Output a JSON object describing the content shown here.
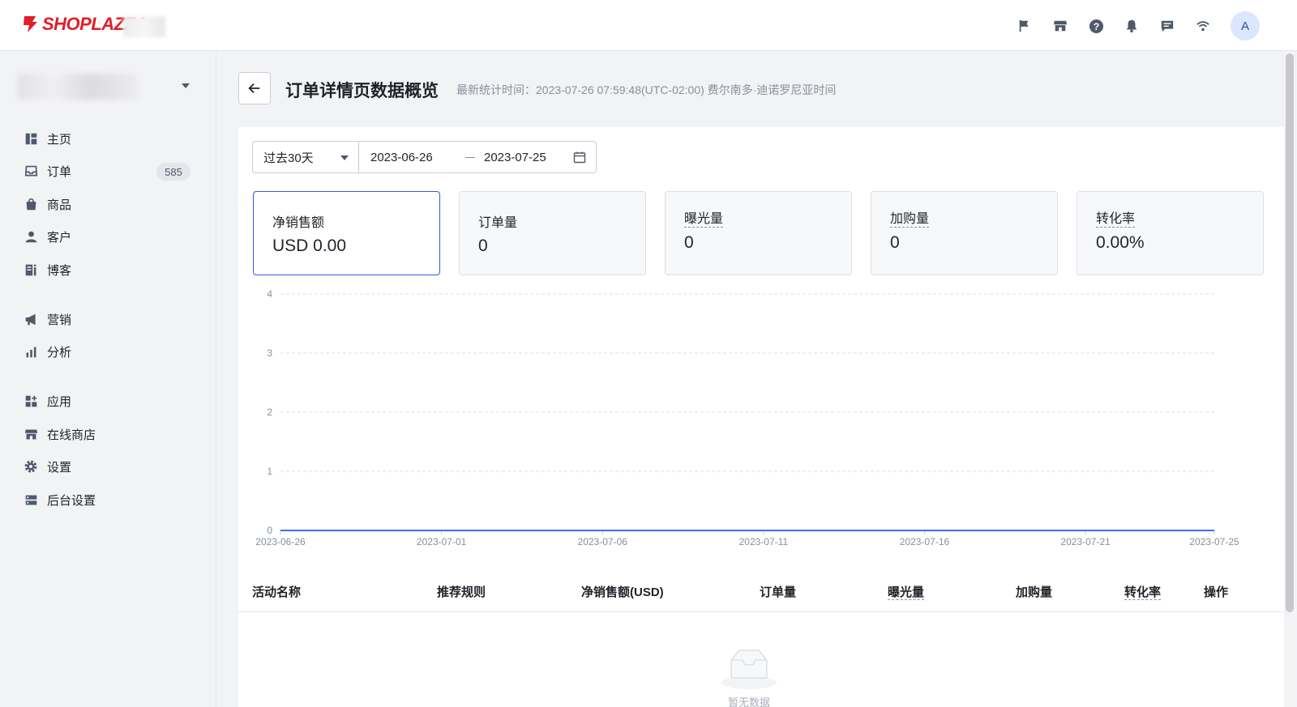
{
  "brand": {
    "name": "SHOPLAZZA",
    "color": "#e11d2a"
  },
  "topbar": {
    "icons": [
      "flag-icon",
      "store-icon",
      "help-icon",
      "bell-icon",
      "message-icon",
      "wifi-icon"
    ],
    "avatar_initial": "A"
  },
  "sidebar": {
    "orders_badge": "585",
    "items": [
      {
        "label": "主页",
        "icon": "dashboard-icon"
      },
      {
        "label": "订单",
        "icon": "inbox-icon"
      },
      {
        "label": "商品",
        "icon": "bag-icon"
      },
      {
        "label": "客户",
        "icon": "person-icon"
      },
      {
        "label": "博客",
        "icon": "blog-icon"
      },
      {
        "label": "营销",
        "icon": "megaphone-icon"
      },
      {
        "label": "分析",
        "icon": "bar-chart-icon"
      },
      {
        "label": "应用",
        "icon": "apps-icon"
      },
      {
        "label": "在线商店",
        "icon": "store-icon"
      },
      {
        "label": "设置",
        "icon": "gear-icon"
      },
      {
        "label": "后台设置",
        "icon": "server-icon"
      }
    ]
  },
  "header": {
    "title": "订单详情页数据概览",
    "meta": "最新统计时间：2023-07-26 07:59:48(UTC-02:00) 费尔南多·迪诺罗尼亚时间"
  },
  "filters": {
    "range_label": "过去30天",
    "start_date": "2023-06-26",
    "end_date": "2023-07-25"
  },
  "metrics": [
    {
      "label": "净销售额",
      "value": "USD 0.00"
    },
    {
      "label": "订单量",
      "value": "0"
    },
    {
      "label": "曝光量",
      "value": "0"
    },
    {
      "label": "加购量",
      "value": "0"
    },
    {
      "label": "转化率",
      "value": "0.00%"
    }
  ],
  "chart_data": {
    "type": "line",
    "x": [
      "2023-06-26",
      "2023-06-27",
      "2023-06-28",
      "2023-06-29",
      "2023-06-30",
      "2023-07-01",
      "2023-07-02",
      "2023-07-03",
      "2023-07-04",
      "2023-07-05",
      "2023-07-06",
      "2023-07-07",
      "2023-07-08",
      "2023-07-09",
      "2023-07-10",
      "2023-07-11",
      "2023-07-12",
      "2023-07-13",
      "2023-07-14",
      "2023-07-15",
      "2023-07-16",
      "2023-07-17",
      "2023-07-18",
      "2023-07-19",
      "2023-07-20",
      "2023-07-21",
      "2023-07-22",
      "2023-07-23",
      "2023-07-24",
      "2023-07-25"
    ],
    "x_tick_labels": [
      "2023-06-26",
      "2023-07-01",
      "2023-07-06",
      "2023-07-11",
      "2023-07-16",
      "2023-07-21",
      "2023-07-25"
    ],
    "series": [
      {
        "values": [
          0,
          0,
          0,
          0,
          0,
          0,
          0,
          0,
          0,
          0,
          0,
          0,
          0,
          0,
          0,
          0,
          0,
          0,
          0,
          0,
          0,
          0,
          0,
          0,
          0,
          0,
          0,
          0,
          0,
          0
        ],
        "color": "#3e6ff5"
      }
    ],
    "y_ticks": [
      "0",
      "1",
      "2",
      "3",
      "4"
    ],
    "ylim": [
      0,
      4
    ],
    "grid": true
  },
  "table": {
    "columns": [
      "活动名称",
      "推荐规则",
      "净销售额(USD)",
      "订单量",
      "曝光量",
      "加购量",
      "转化率",
      "操作"
    ],
    "empty_text": "暂无数据"
  }
}
